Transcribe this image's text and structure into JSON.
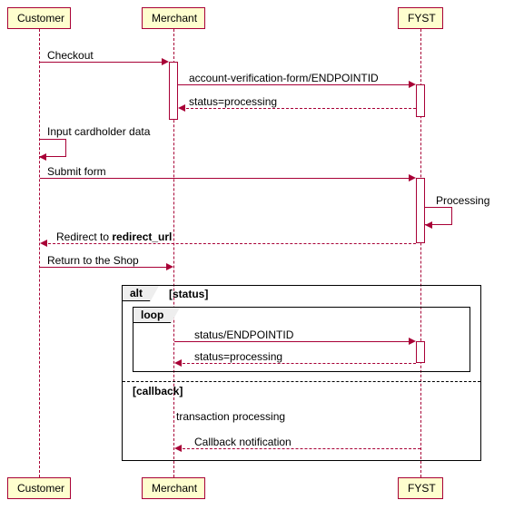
{
  "actors": {
    "customer": "Customer",
    "merchant": "Merchant",
    "fyst": "FYST"
  },
  "messages": {
    "checkout": "Checkout",
    "acct_verif": "account-verification-form/ENDPOINTID",
    "status_proc": "status=processing",
    "input_card": "Input cardholder data",
    "submit": "Submit form",
    "processing": "Processing",
    "redirect": "Redirect to ",
    "redirect_bold": "redirect_url",
    "return_shop": "Return to the Shop",
    "status_ep": "status/ENDPOINTID",
    "status_proc2": "status=processing",
    "txn_proc": "transaction processing",
    "callback_notif": "Callback notification"
  },
  "fragments": {
    "alt": "alt",
    "alt_cond": "[status]",
    "loop": "loop",
    "callback": "[callback]"
  }
}
